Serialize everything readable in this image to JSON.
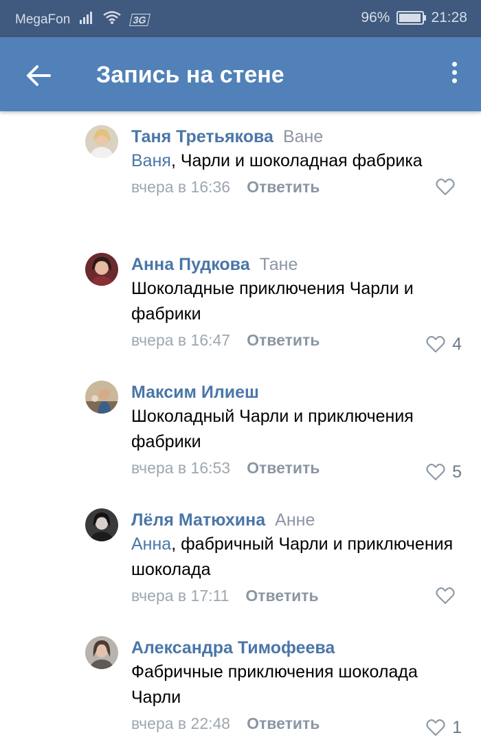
{
  "status_bar": {
    "carrier": "MegaFon",
    "network_type": "3G",
    "battery": "96%",
    "time": "21:28"
  },
  "app_bar": {
    "title": "Запись на стене"
  },
  "comments": [
    {
      "author": "Таня Третьякова",
      "reply_to": "Ване",
      "mention": "Ваня",
      "text": ", Чарли и шоколадная фабрика",
      "time": "вчера в 16:36",
      "reply_label": "Ответить",
      "likes": ""
    },
    {
      "author": "Анна Пудкова",
      "reply_to": "Тане",
      "mention": "",
      "text": "Шоколадные приключения Чарли и фабрики",
      "time": "вчера в 16:47",
      "reply_label": "Ответить",
      "likes": "4"
    },
    {
      "author": "Максим Илиеш",
      "reply_to": "",
      "mention": "",
      "text": "Шоколадный Чарли и приключения фабрики",
      "time": "вчера в 16:53",
      "reply_label": "Ответить",
      "likes": "5"
    },
    {
      "author": "Лёля Матюхина",
      "reply_to": "Анне",
      "mention": "Анна",
      "text": ", фабричный Чарли и приключения шоколада",
      "time": "вчера в 17:11",
      "reply_label": "Ответить",
      "likes": ""
    },
    {
      "author": "Александра Тимофеева",
      "reply_to": "",
      "mention": "",
      "text": "Фабричные приключения шоколада Чарли",
      "time": "вчера в 22:48",
      "reply_label": "Ответить",
      "likes": "1"
    }
  ],
  "colors": {
    "status_bar": "#3f5a7e",
    "app_bar": "#5181b8",
    "link": "#4a76a8",
    "muted": "#9da6b0"
  }
}
